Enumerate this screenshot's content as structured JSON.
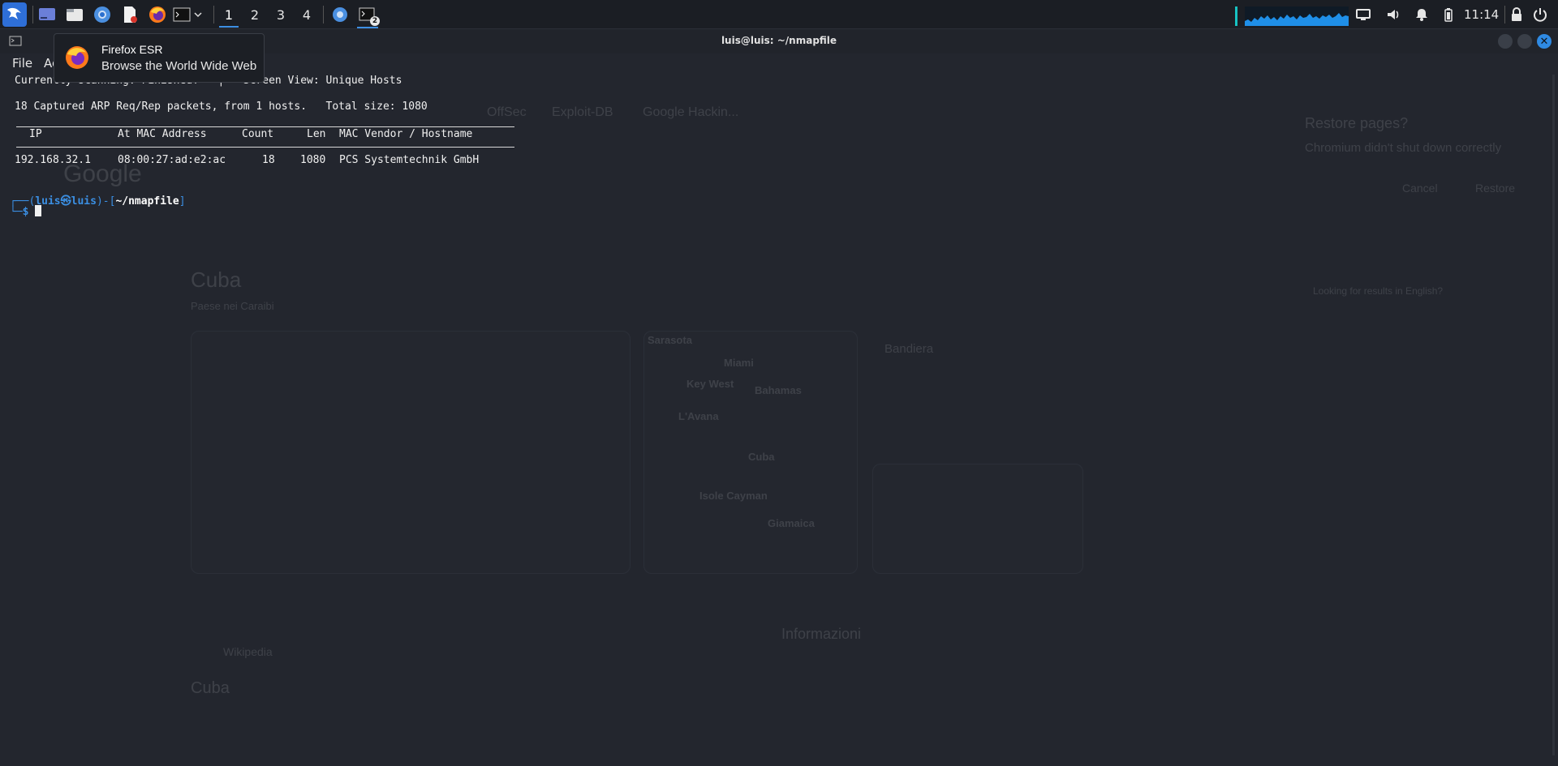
{
  "panel": {
    "workspaces": [
      "1",
      "2",
      "3",
      "4"
    ],
    "active_workspace": "1",
    "terminal_badge": "2",
    "clock": "11:14",
    "cpu_graph_color": "#17c3c3"
  },
  "tooltip": {
    "title": "Firefox ESR",
    "subtitle": "Browse the World Wide Web"
  },
  "window": {
    "title": "luis@luis: ~/nmapfile",
    "menu": [
      "File",
      "Acti"
    ]
  },
  "terminal": {
    "status_line": "Currently scanning: Finished!   |   Screen View: Unique Hosts",
    "summary_line": "18 Captured ARP Req/Rep packets, from 1 hosts.   Total size: 1080",
    "headers": {
      "ip": "IP",
      "mac": "At MAC Address",
      "count": "Count",
      "len": "Len",
      "vendor": "MAC Vendor / Hostname"
    },
    "rows": [
      {
        "ip": "192.168.32.1",
        "mac": "08:00:27:ad:e2:ac",
        "count": "18",
        "len": "1080",
        "vendor": "PCS Systemtechnik GmbH"
      }
    ],
    "prompt": {
      "open": "┌──(",
      "user": "luis",
      "at": "㉿",
      "host": "luis",
      "mid": ")-[",
      "path": "~/nmapfile",
      "close": "]",
      "second": "└─",
      "dollar": "$"
    }
  },
  "background_browser": {
    "bookmarks": [
      "OffSec",
      "Exploit-DB",
      "Google Hackin..."
    ],
    "restore": {
      "title": "Restore pages?",
      "message": "Chromium didn't shut down correctly",
      "cancel": "Cancel",
      "restore": "Restore"
    },
    "search_logo": "Google",
    "result_title": "Cuba",
    "result_subtitle": "Paese nei Caraibi",
    "map_labels": [
      "Sarasota",
      "Miami",
      "Key West",
      "Bahamas",
      "L'Avana",
      "Cuba",
      "Isole Cayman",
      "Giamaica"
    ],
    "flag_label": "Bandiera",
    "info_title": "Informazioni",
    "wiki_source": "Wikipedia",
    "wiki_title": "Cuba",
    "english_hint": "Looking for results in English?"
  },
  "colors": {
    "accent": "#3b8fe3",
    "panel_bg": "#1b1e24",
    "terminal_bg": "#23262e"
  }
}
